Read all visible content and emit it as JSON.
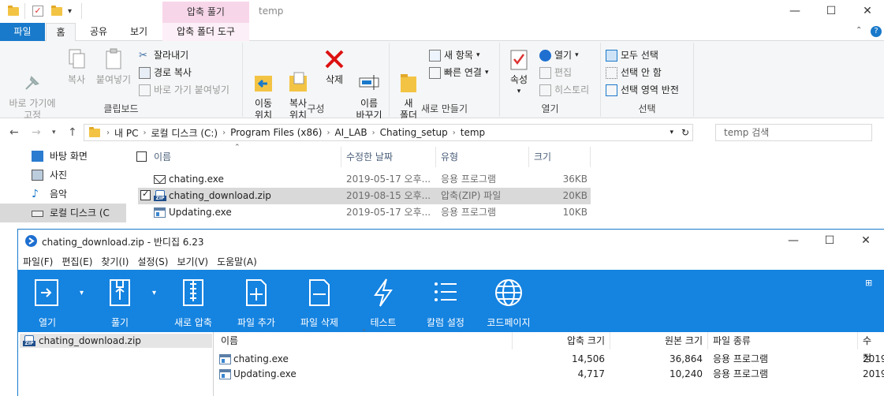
{
  "explorer": {
    "window_title": "temp",
    "context_tab_header": "압축 풀기",
    "window_controls": [
      "—",
      "☐",
      "✕"
    ],
    "tabs": [
      "파일",
      "홈",
      "공유",
      "보기",
      "압축 폴더 도구"
    ],
    "ribbon": {
      "clipboard": {
        "group": "클립보드",
        "pin": "바로 가기에\n고정",
        "copy": "복사",
        "paste": "붙여넣기",
        "cut": "잘라내기",
        "copy_path": "경로 복사",
        "paste_shortcut": "바로 가기 붙여넣기"
      },
      "organize": {
        "group": "구성",
        "move": "이동\n위치",
        "copy_to": "복사\n위치",
        "delete": "삭제",
        "rename": "이름\n바꾸기"
      },
      "new": {
        "group": "새로 만들기",
        "new_folder": "새\n폴더",
        "new_item": "새 항목",
        "easy_access": "빠른 연결"
      },
      "open": {
        "group": "열기",
        "properties": "속성",
        "open": "열기",
        "edit": "편집",
        "history": "히스토리"
      },
      "select": {
        "group": "선택",
        "select_all": "모두 선택",
        "select_none": "선택 안 함",
        "invert": "선택 영역 반전"
      }
    },
    "address": {
      "crumbs": [
        "내 PC",
        "로컬 디스크 (C:)",
        "Program Files (x86)",
        "AI_LAB",
        "Chating_setup",
        "temp"
      ],
      "search_placeholder": "temp 검색"
    },
    "nav_pane": [
      "바탕 화면",
      "사진",
      "음악",
      "로컬 디스크 (C"
    ],
    "columns": [
      "이름",
      "수정한 날짜",
      "유형",
      "크기"
    ],
    "files": [
      {
        "name": "chating.exe",
        "date": "2019-05-17 오후...",
        "type": "응용 프로그램",
        "size": "36KB",
        "icon": "mail-icon",
        "selected": false
      },
      {
        "name": "chating_download.zip",
        "date": "2019-08-15 오후...",
        "type": "압축(ZIP) 파일",
        "size": "20KB",
        "icon": "zip-icon",
        "selected": true
      },
      {
        "name": "Updating.exe",
        "date": "2019-05-17 오후...",
        "type": "응용 프로그램",
        "size": "10KB",
        "icon": "exe-icon",
        "selected": false
      }
    ]
  },
  "bandizip": {
    "title": "chating_download.zip - 반디집 6.23",
    "menu": [
      "파일(F)",
      "편집(E)",
      "찾기(I)",
      "설정(S)",
      "보기(V)",
      "도움말(A)"
    ],
    "toolbar": [
      "열기",
      "풀기",
      "새로 압축",
      "파일 추가",
      "파일 삭제",
      "테스트",
      "칼럼 설정",
      "코드페이지"
    ],
    "tree_item": "chating_download.zip",
    "columns": [
      "이름",
      "압축 크기",
      "원본 크기",
      "파일 종류",
      "수정"
    ],
    "files": [
      {
        "name": "chating.exe",
        "packed": "14,506",
        "original": "36,864",
        "type": "응용 프로그램",
        "modified": "2019"
      },
      {
        "name": "Updating.exe",
        "packed": "4,717",
        "original": "10,240",
        "type": "응용 프로그램",
        "modified": "2019"
      }
    ]
  },
  "colors": {
    "accent": "#1979ca",
    "toolbar_blue": "#1583e0",
    "context_tab": "#f8d6ea",
    "selection": "#d9d9d9"
  }
}
